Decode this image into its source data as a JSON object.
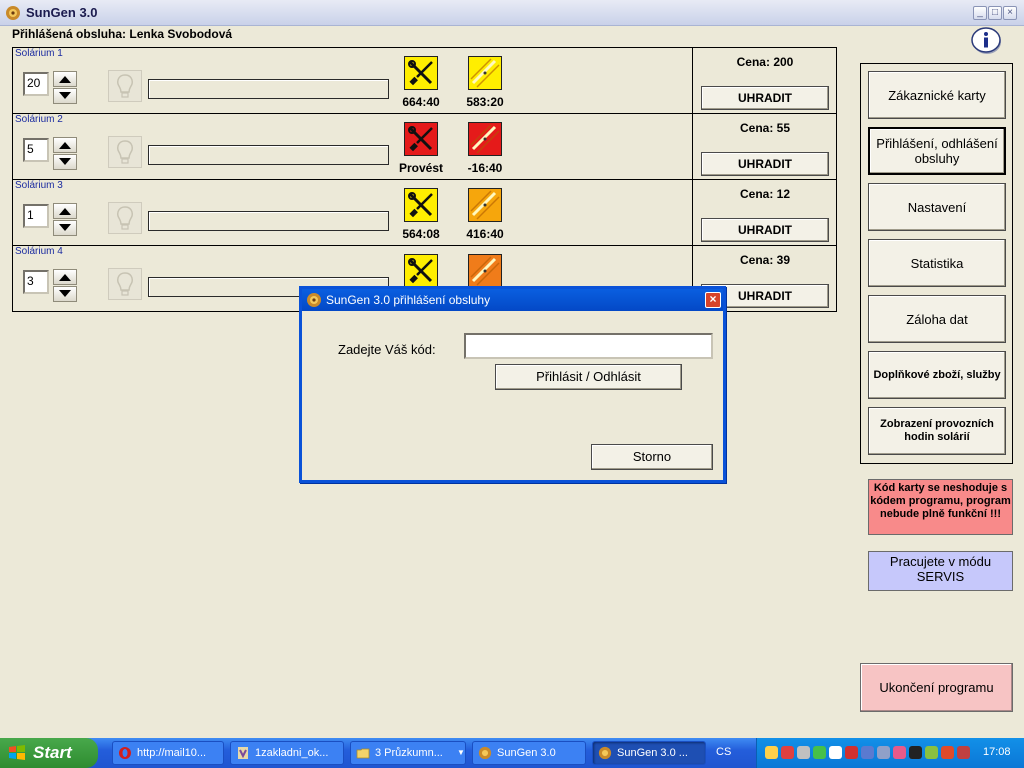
{
  "window": {
    "title": "SunGen 3.0"
  },
  "operator": {
    "label": "Přihlášená obsluha: Lenka Svobodová"
  },
  "solariums": [
    {
      "name": "Solárium 1",
      "minutes": "20",
      "tube1_value": "664:40",
      "tube1_status": "ok",
      "tube2_value": "583:20",
      "tube2_color": "#ffee00",
      "price": "Cena: 200",
      "pay_label": "UHRADIT"
    },
    {
      "name": "Solárium 2",
      "minutes": "5",
      "tube1_value": "Provést",
      "tube1_status": "alert",
      "tube2_value": "-16:40",
      "tube2_color": "#e51a1a",
      "price": "Cena: 55",
      "pay_label": "UHRADIT"
    },
    {
      "name": "Solárium 3",
      "minutes": "1",
      "tube1_value": "564:08",
      "tube1_status": "ok",
      "tube2_value": "416:40",
      "tube2_color": "#f6a60c",
      "price": "Cena: 12",
      "pay_label": "UHRADIT"
    },
    {
      "name": "Solárium 4",
      "minutes": "3",
      "tube1_value": "",
      "tube1_status": "ok",
      "tube2_value": "",
      "tube2_color": "#f07c1a",
      "price": "Cena: 39",
      "pay_label": "UHRADIT"
    }
  ],
  "menu": {
    "items": [
      {
        "label": "Zákaznické karty"
      },
      {
        "label": "Přihlášení, odhlášení obsluhy"
      },
      {
        "label": "Nastavení"
      },
      {
        "label": "Statistika"
      },
      {
        "label": "Záloha dat"
      },
      {
        "label": "Doplňkové zboží, služby"
      },
      {
        "label": "Zobrazení provozních hodin solárií"
      }
    ]
  },
  "warning": {
    "text": "Kód karty se neshoduje s kódem programu, program nebude plně funkční !!!"
  },
  "mode": {
    "text": "Pracujete v módu SERVIS"
  },
  "exit": {
    "label": "Ukončení programu"
  },
  "dialog": {
    "title": "SunGen 3.0 přihlášení obsluhy",
    "code_label": "Zadejte Váš kód:",
    "code_value": "",
    "login_label": "Přihlásit / Odhlásit",
    "cancel_label": "Storno"
  },
  "taskbar": {
    "start_label": "Start",
    "tasks": [
      {
        "label": "http://mail10...",
        "icon": "opera-icon"
      },
      {
        "label": "1zakladni_ok...",
        "icon": "image-icon"
      },
      {
        "label": "3 Průzkumn...",
        "icon": "folder-icon"
      },
      {
        "label": "SunGen 3.0",
        "icon": "sungen-icon"
      },
      {
        "label": "SunGen 3.0 ...",
        "icon": "sungen-icon"
      }
    ],
    "language": "CS",
    "clock": "17:08"
  },
  "colors": {
    "accent": "#0a52d8",
    "warning_bg": "#f88a8a",
    "mode_bg": "#c6c8fb",
    "exit_bg": "#f7c4c4",
    "tool_ok": "#ffee00",
    "tool_alert": "#e51a1a"
  }
}
